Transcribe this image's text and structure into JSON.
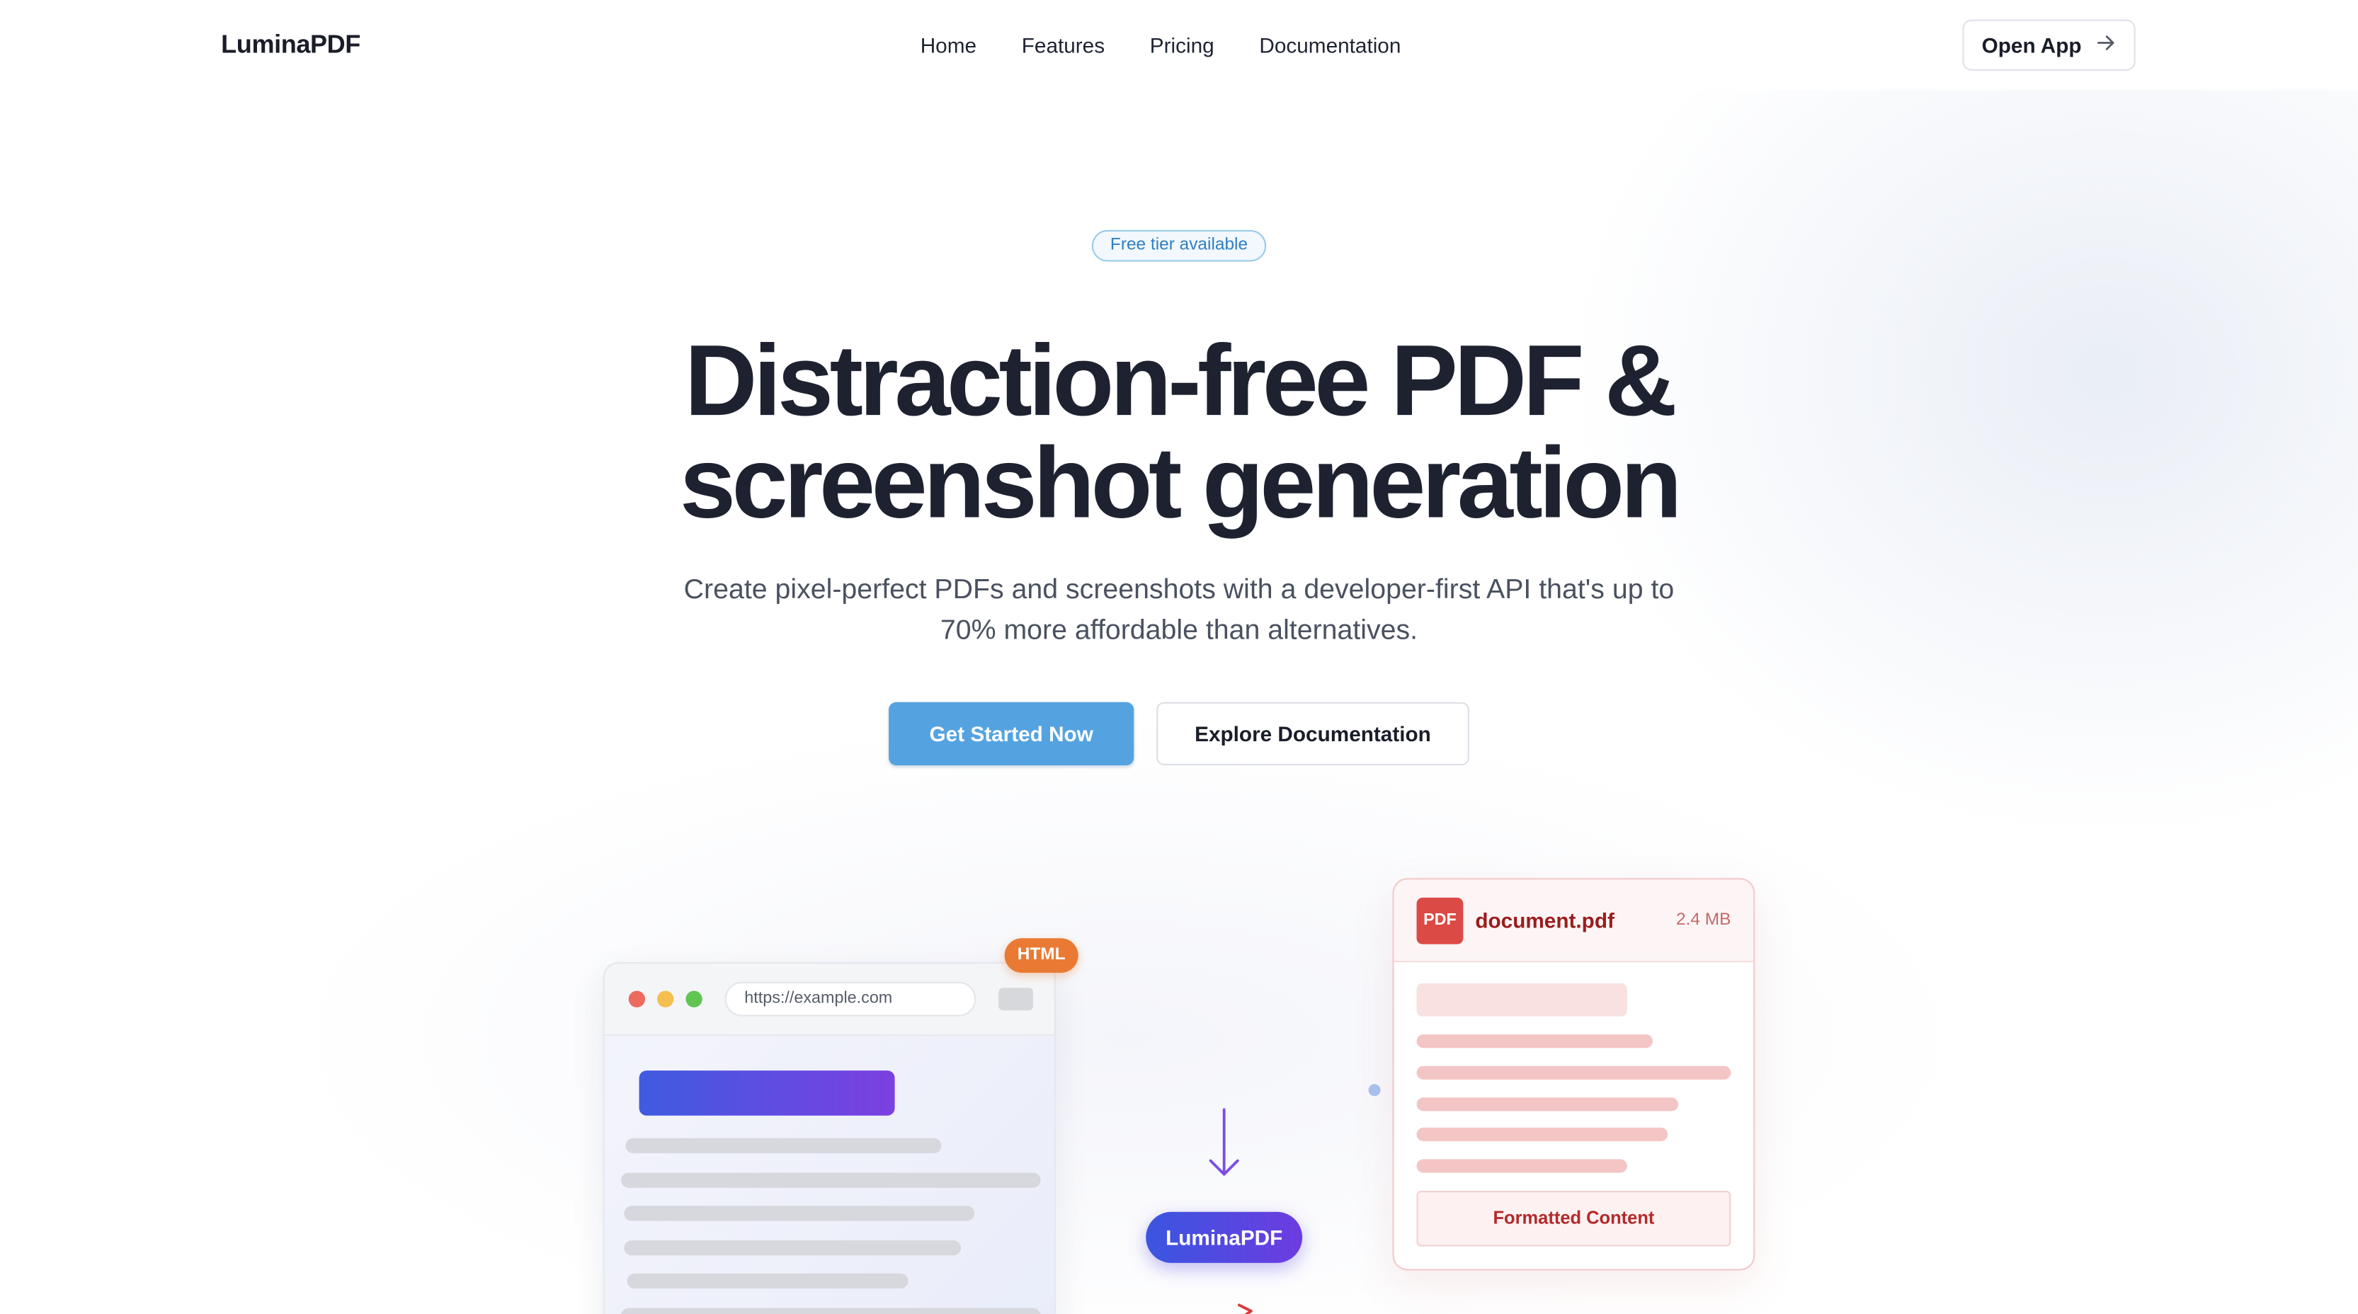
{
  "nav": {
    "logo": "LuminaPDF",
    "links": [
      {
        "label": "Home"
      },
      {
        "label": "Features"
      },
      {
        "label": "Pricing"
      },
      {
        "label": "Documentation"
      }
    ],
    "open_app_label": "Open App",
    "open_app_icon": "arrow-right-icon"
  },
  "hero": {
    "badge": "Free tier available",
    "headline_line1": "Distraction-free PDF &",
    "headline_line2": "screenshot generation",
    "subheadline": "Create pixel-perfect PDFs and screenshots with a developer-first API that's up to 70% more affordable than alternatives.",
    "primary_cta": "Get Started Now",
    "secondary_cta": "Explore Documentation"
  },
  "illustration": {
    "browser": {
      "url": "https://example.com",
      "tag": "HTML"
    },
    "pipeline_label": "LuminaPDF",
    "pdf": {
      "icon_label": "PDF",
      "filename": "document.pdf",
      "size": "2.4 MB",
      "footer_label": "Formatted Content"
    }
  },
  "colors": {
    "primary_button": "#54a3e0",
    "brand_gradient_start": "#3a56e0",
    "brand_gradient_end": "#6d3ce0",
    "html_tag": "#ea7a33",
    "pdf_accent": "#dc4a45"
  }
}
